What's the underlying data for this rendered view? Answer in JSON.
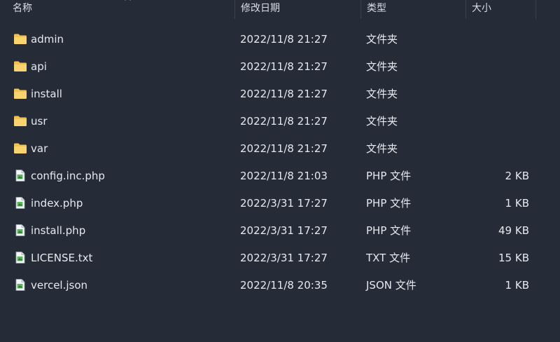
{
  "columns": {
    "name": "名称",
    "date": "修改日期",
    "type": "类型",
    "size": "大小"
  },
  "files": [
    {
      "name": "admin",
      "date": "2022/11/8 21:27",
      "type": "文件夹",
      "size": "",
      "icon": "folder-icon"
    },
    {
      "name": "api",
      "date": "2022/11/8 21:27",
      "type": "文件夹",
      "size": "",
      "icon": "folder-icon"
    },
    {
      "name": "install",
      "date": "2022/11/8 21:27",
      "type": "文件夹",
      "size": "",
      "icon": "folder-icon"
    },
    {
      "name": "usr",
      "date": "2022/11/8 21:27",
      "type": "文件夹",
      "size": "",
      "icon": "folder-icon"
    },
    {
      "name": "var",
      "date": "2022/11/8 21:27",
      "type": "文件夹",
      "size": "",
      "icon": "folder-icon"
    },
    {
      "name": "config.inc.php",
      "date": "2022/11/8 21:03",
      "type": "PHP 文件",
      "size": "2 KB",
      "icon": "file-icon"
    },
    {
      "name": "index.php",
      "date": "2022/3/31 17:27",
      "type": "PHP 文件",
      "size": "1 KB",
      "icon": "file-icon"
    },
    {
      "name": "install.php",
      "date": "2022/3/31 17:27",
      "type": "PHP 文件",
      "size": "49 KB",
      "icon": "file-icon"
    },
    {
      "name": "LICENSE.txt",
      "date": "2022/3/31 17:27",
      "type": "TXT 文件",
      "size": "15 KB",
      "icon": "file-icon"
    },
    {
      "name": "vercel.json",
      "date": "2022/11/8 20:35",
      "type": "JSON 文件",
      "size": "1 KB",
      "icon": "file-icon"
    }
  ],
  "colors": {
    "background": "#252c38",
    "text": "#e6e9ee",
    "folder": "#f2c14e",
    "file_accent": "#5cb85c"
  }
}
